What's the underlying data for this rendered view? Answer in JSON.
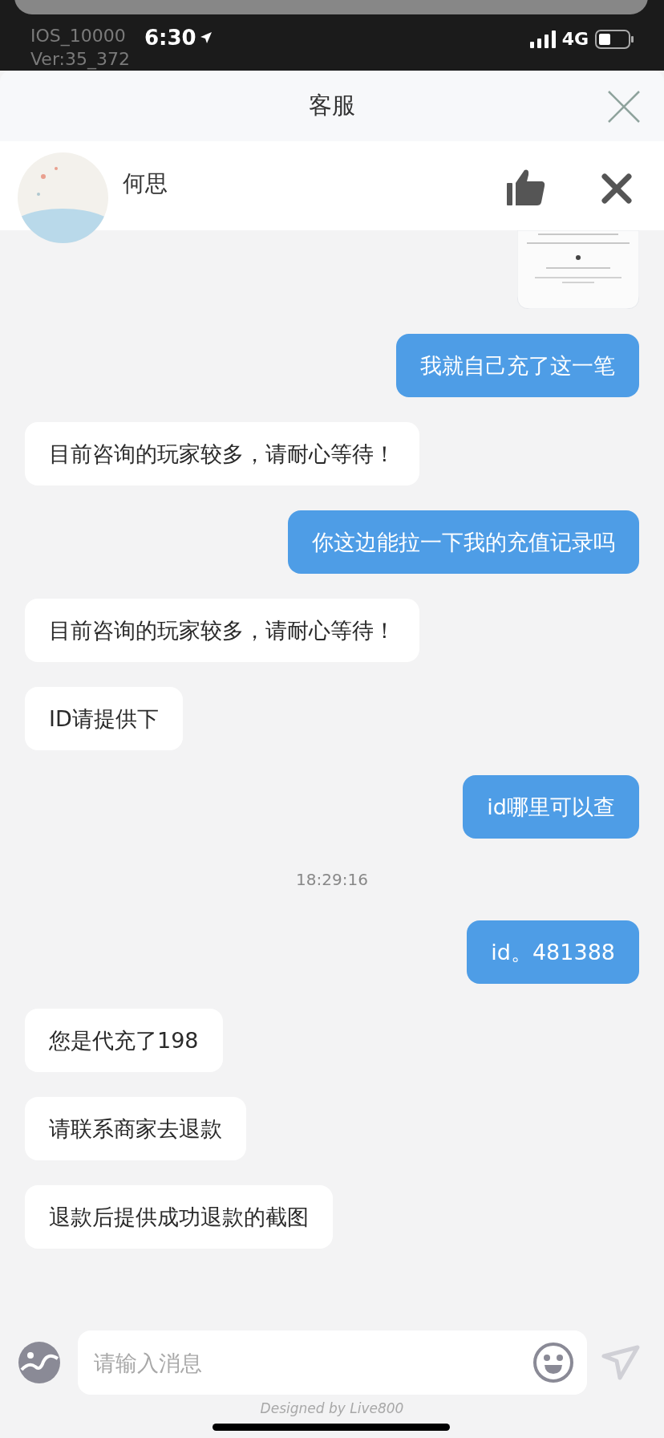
{
  "status_bar": {
    "time": "6:30",
    "network": "4G",
    "debug_lines": [
      "IOS_10000",
      "Ver:35_372"
    ]
  },
  "header": {
    "title": "客服"
  },
  "agent": {
    "name": "何思"
  },
  "messages": [
    {
      "kind": "picture"
    },
    {
      "kind": "outgoing",
      "text": "我就自己充了这一笔"
    },
    {
      "kind": "incoming",
      "text": "目前咨询的玩家较多，请耐心等待！"
    },
    {
      "kind": "outgoing",
      "text": "你这边能拉一下我的充值记录吗"
    },
    {
      "kind": "incoming",
      "text": "目前咨询的玩家较多，请耐心等待！"
    },
    {
      "kind": "incoming",
      "text": "ID请提供下"
    },
    {
      "kind": "outgoing",
      "text": "id哪里可以查"
    },
    {
      "kind": "time",
      "text": "18:29:16"
    },
    {
      "kind": "outgoing",
      "text": "id。481388"
    },
    {
      "kind": "incoming",
      "text": "您是代充了198"
    },
    {
      "kind": "incoming",
      "text": "请联系商家去退款"
    },
    {
      "kind": "incoming",
      "text": "退款后提供成功退款的截图"
    }
  ],
  "composer": {
    "placeholder": "请输入消息"
  },
  "footer": "Designed by Live800"
}
